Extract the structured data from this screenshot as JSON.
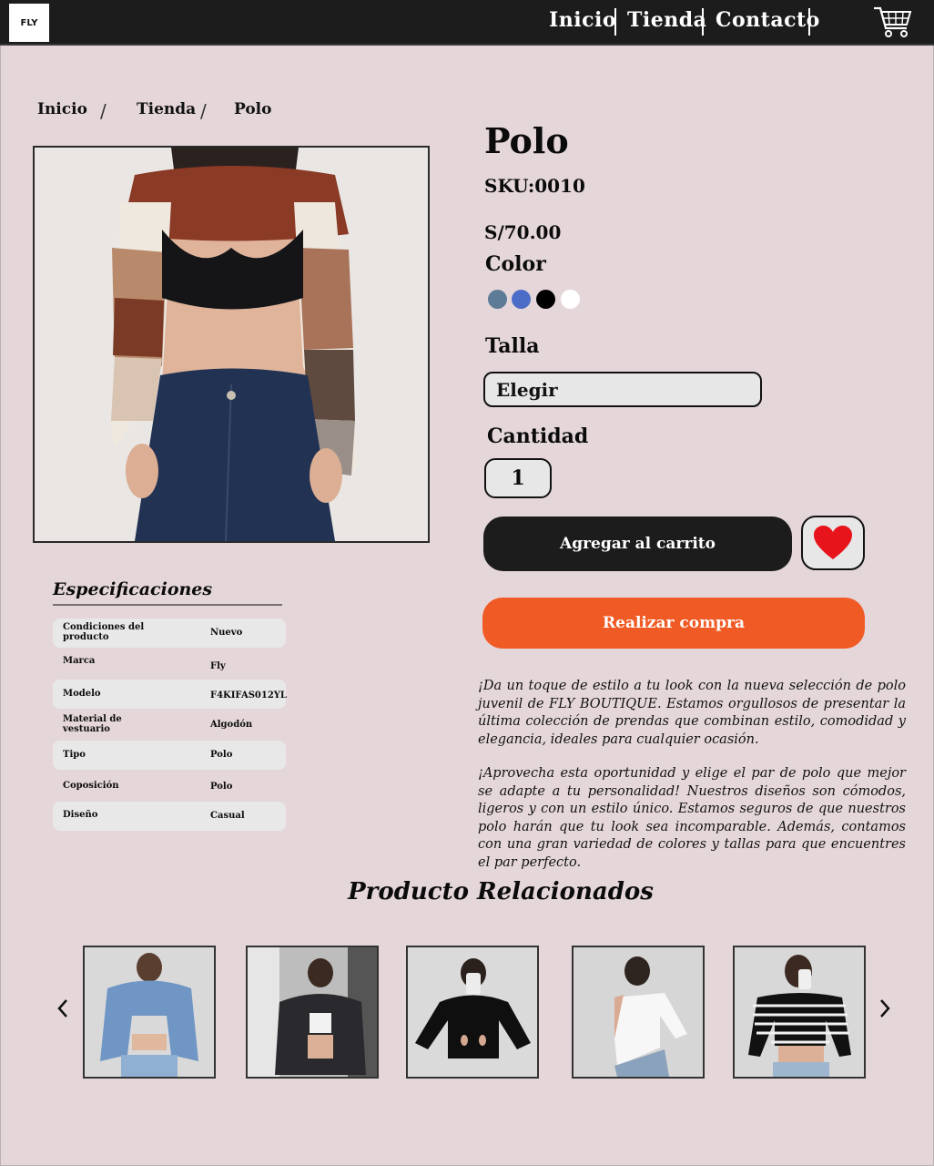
{
  "header": {
    "logo": "FLY",
    "nav": [
      "Inicio",
      "Tienda",
      "Contacto"
    ]
  },
  "breadcrumb": [
    "Inicio",
    "Tienda",
    "Polo"
  ],
  "product": {
    "title": "Polo",
    "sku": "SKU:0010",
    "price": "S/70.00",
    "color_label": "Color",
    "colors": [
      "#5d7a97",
      "#4b6cc7",
      "#000000",
      "#ffffff"
    ],
    "size_label": "Talla",
    "size_value": "Elegir",
    "qty_label": "Cantidad",
    "qty_value": "1",
    "add_to_cart": "Agregar al carrito",
    "buy_now": "Realizar compra",
    "description": [
      "¡Da un toque de estilo a tu look con la nueva selección de polo juvenil de FLY BOUTIQUE. Estamos orgullosos de presentar la última colección de prendas que combinan estilo, comodidad y elegancia, ideales para cualquier ocasión.",
      "¡Aprovecha esta oportunidad y elige el par de polo que mejor se adapte a tu personalidad! Nuestros diseños son cómodos, ligeros y con un estilo único. Estamos seguros de que nuestros polo harán que tu look sea incomparable. Además, contamos con una gran variedad de colores y tallas para que encuentres el par perfecto."
    ]
  },
  "specs": {
    "title": "Especificaciones",
    "rows": [
      {
        "k": "Condiciones del producto",
        "v": "Nuevo"
      },
      {
        "k": "Marca",
        "v": "Fly"
      },
      {
        "k": "Modelo",
        "v": "F4KIFAS012YL"
      },
      {
        "k": "Material de vestuario",
        "v": "Algodón"
      },
      {
        "k": "Tipo",
        "v": "Polo"
      },
      {
        "k": "Coposición",
        "v": "Polo"
      },
      {
        "k": "Diseño",
        "v": "Casual"
      }
    ]
  },
  "related": {
    "title": "Producto Relacionados"
  }
}
